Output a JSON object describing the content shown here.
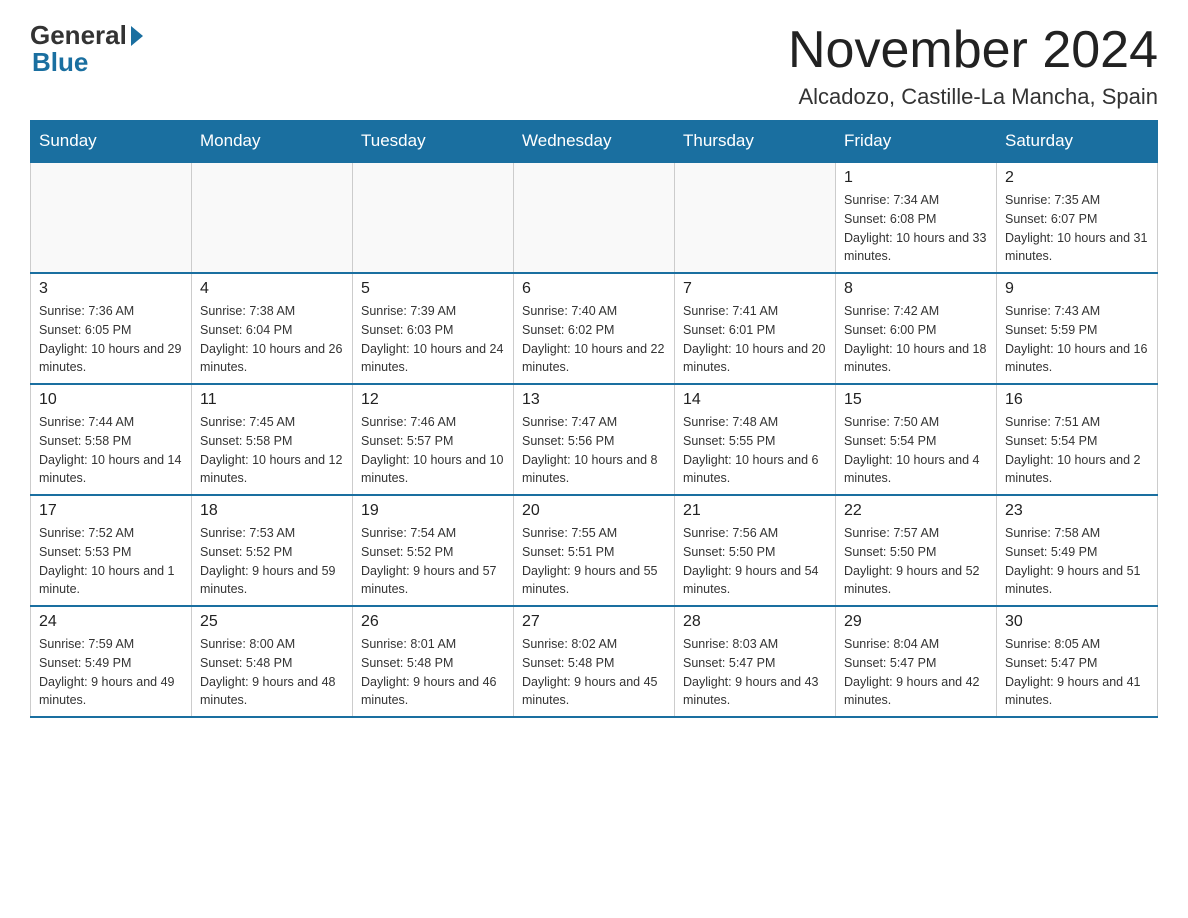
{
  "header": {
    "logo_general": "General",
    "logo_blue": "Blue",
    "month_title": "November 2024",
    "subtitle": "Alcadozo, Castille-La Mancha, Spain"
  },
  "days_of_week": [
    "Sunday",
    "Monday",
    "Tuesday",
    "Wednesday",
    "Thursday",
    "Friday",
    "Saturday"
  ],
  "weeks": [
    [
      {
        "day": "",
        "info": ""
      },
      {
        "day": "",
        "info": ""
      },
      {
        "day": "",
        "info": ""
      },
      {
        "day": "",
        "info": ""
      },
      {
        "day": "",
        "info": ""
      },
      {
        "day": "1",
        "info": "Sunrise: 7:34 AM\nSunset: 6:08 PM\nDaylight: 10 hours and 33 minutes."
      },
      {
        "day": "2",
        "info": "Sunrise: 7:35 AM\nSunset: 6:07 PM\nDaylight: 10 hours and 31 minutes."
      }
    ],
    [
      {
        "day": "3",
        "info": "Sunrise: 7:36 AM\nSunset: 6:05 PM\nDaylight: 10 hours and 29 minutes."
      },
      {
        "day": "4",
        "info": "Sunrise: 7:38 AM\nSunset: 6:04 PM\nDaylight: 10 hours and 26 minutes."
      },
      {
        "day": "5",
        "info": "Sunrise: 7:39 AM\nSunset: 6:03 PM\nDaylight: 10 hours and 24 minutes."
      },
      {
        "day": "6",
        "info": "Sunrise: 7:40 AM\nSunset: 6:02 PM\nDaylight: 10 hours and 22 minutes."
      },
      {
        "day": "7",
        "info": "Sunrise: 7:41 AM\nSunset: 6:01 PM\nDaylight: 10 hours and 20 minutes."
      },
      {
        "day": "8",
        "info": "Sunrise: 7:42 AM\nSunset: 6:00 PM\nDaylight: 10 hours and 18 minutes."
      },
      {
        "day": "9",
        "info": "Sunrise: 7:43 AM\nSunset: 5:59 PM\nDaylight: 10 hours and 16 minutes."
      }
    ],
    [
      {
        "day": "10",
        "info": "Sunrise: 7:44 AM\nSunset: 5:58 PM\nDaylight: 10 hours and 14 minutes."
      },
      {
        "day": "11",
        "info": "Sunrise: 7:45 AM\nSunset: 5:58 PM\nDaylight: 10 hours and 12 minutes."
      },
      {
        "day": "12",
        "info": "Sunrise: 7:46 AM\nSunset: 5:57 PM\nDaylight: 10 hours and 10 minutes."
      },
      {
        "day": "13",
        "info": "Sunrise: 7:47 AM\nSunset: 5:56 PM\nDaylight: 10 hours and 8 minutes."
      },
      {
        "day": "14",
        "info": "Sunrise: 7:48 AM\nSunset: 5:55 PM\nDaylight: 10 hours and 6 minutes."
      },
      {
        "day": "15",
        "info": "Sunrise: 7:50 AM\nSunset: 5:54 PM\nDaylight: 10 hours and 4 minutes."
      },
      {
        "day": "16",
        "info": "Sunrise: 7:51 AM\nSunset: 5:54 PM\nDaylight: 10 hours and 2 minutes."
      }
    ],
    [
      {
        "day": "17",
        "info": "Sunrise: 7:52 AM\nSunset: 5:53 PM\nDaylight: 10 hours and 1 minute."
      },
      {
        "day": "18",
        "info": "Sunrise: 7:53 AM\nSunset: 5:52 PM\nDaylight: 9 hours and 59 minutes."
      },
      {
        "day": "19",
        "info": "Sunrise: 7:54 AM\nSunset: 5:52 PM\nDaylight: 9 hours and 57 minutes."
      },
      {
        "day": "20",
        "info": "Sunrise: 7:55 AM\nSunset: 5:51 PM\nDaylight: 9 hours and 55 minutes."
      },
      {
        "day": "21",
        "info": "Sunrise: 7:56 AM\nSunset: 5:50 PM\nDaylight: 9 hours and 54 minutes."
      },
      {
        "day": "22",
        "info": "Sunrise: 7:57 AM\nSunset: 5:50 PM\nDaylight: 9 hours and 52 minutes."
      },
      {
        "day": "23",
        "info": "Sunrise: 7:58 AM\nSunset: 5:49 PM\nDaylight: 9 hours and 51 minutes."
      }
    ],
    [
      {
        "day": "24",
        "info": "Sunrise: 7:59 AM\nSunset: 5:49 PM\nDaylight: 9 hours and 49 minutes."
      },
      {
        "day": "25",
        "info": "Sunrise: 8:00 AM\nSunset: 5:48 PM\nDaylight: 9 hours and 48 minutes."
      },
      {
        "day": "26",
        "info": "Sunrise: 8:01 AM\nSunset: 5:48 PM\nDaylight: 9 hours and 46 minutes."
      },
      {
        "day": "27",
        "info": "Sunrise: 8:02 AM\nSunset: 5:48 PM\nDaylight: 9 hours and 45 minutes."
      },
      {
        "day": "28",
        "info": "Sunrise: 8:03 AM\nSunset: 5:47 PM\nDaylight: 9 hours and 43 minutes."
      },
      {
        "day": "29",
        "info": "Sunrise: 8:04 AM\nSunset: 5:47 PM\nDaylight: 9 hours and 42 minutes."
      },
      {
        "day": "30",
        "info": "Sunrise: 8:05 AM\nSunset: 5:47 PM\nDaylight: 9 hours and 41 minutes."
      }
    ]
  ]
}
